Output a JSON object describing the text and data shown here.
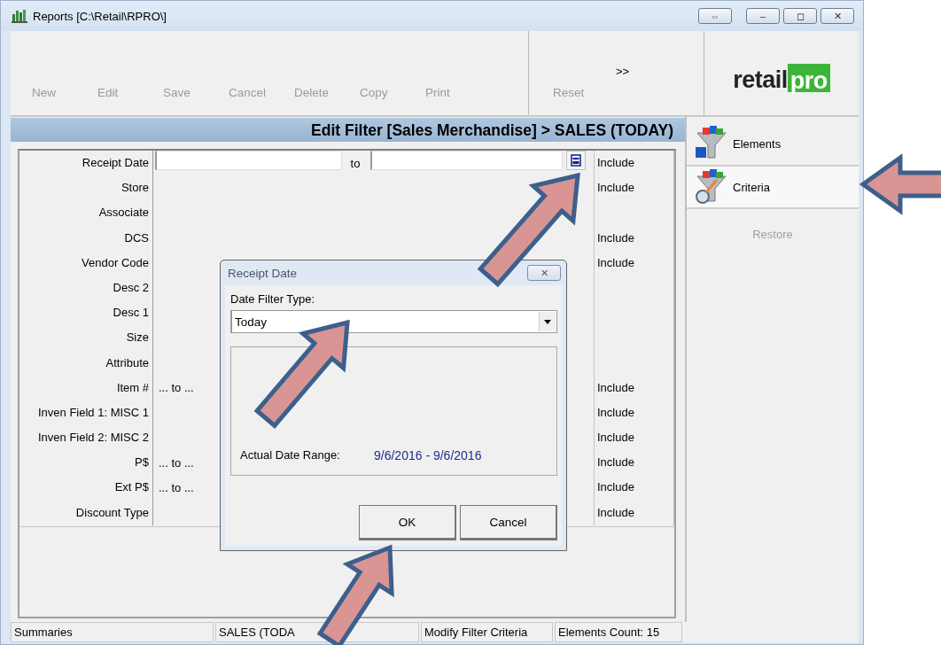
{
  "window": {
    "title": "Reports [C:\\Retail\\RPRO\\]",
    "buttons": [
      "⇔",
      "‒",
      "◻",
      "✕"
    ]
  },
  "toolbar": {
    "buttons": [
      {
        "label": "New",
        "disabled": true
      },
      {
        "label": "Edit",
        "disabled": true
      },
      {
        "label": "Save",
        "disabled": true
      },
      {
        "label": "Cancel",
        "disabled": true
      },
      {
        "label": "Delete",
        "disabled": true
      },
      {
        "label": "Copy",
        "disabled": true
      },
      {
        "label": "Print",
        "disabled": true
      }
    ],
    "reset": {
      "label": "Reset",
      "disabled": true
    },
    "more": ">>"
  },
  "logo": {
    "text_1": "retail",
    "text_2": "pro"
  },
  "header": "Edit Filter [Sales Merchandise] > SALES (TODAY)",
  "filters": [
    {
      "label": "Receipt Date",
      "kind": "date_range",
      "to": "to",
      "include": "Include"
    },
    {
      "label": "Store",
      "kind": "none",
      "include": "Include"
    },
    {
      "label": "Associate",
      "kind": "none"
    },
    {
      "label": "DCS",
      "kind": "none",
      "include": "Include"
    },
    {
      "label": "Vendor Code",
      "kind": "none",
      "include": "Include"
    },
    {
      "label": "Desc 2",
      "kind": "none"
    },
    {
      "label": "Desc 1",
      "kind": "none"
    },
    {
      "label": "Size",
      "kind": "none"
    },
    {
      "label": "Attribute",
      "kind": "none"
    },
    {
      "label": "Item #",
      "kind": "range",
      "value": "... to ...",
      "include": "Include"
    },
    {
      "label": "Inven Field 1: MISC 1",
      "kind": "none",
      "include": "Include"
    },
    {
      "label": "Inven Field 2: MISC 2",
      "kind": "none",
      "include": "Include"
    },
    {
      "label": "P$",
      "kind": "range",
      "value": "... to ...",
      "include": "Include"
    },
    {
      "label": "Ext P$",
      "kind": "range",
      "value": "... to ...",
      "include": "Include"
    },
    {
      "label": "Discount Type",
      "kind": "none",
      "include": "Include"
    }
  ],
  "side_panel": {
    "items": [
      {
        "label": "Elements",
        "selected": false
      },
      {
        "label": "Criteria",
        "selected": true
      }
    ],
    "restore": {
      "label": "Restore",
      "disabled": true
    }
  },
  "dialog": {
    "title": "Receipt Date",
    "close": "✕",
    "field_label": "Date Filter Type:",
    "select_value": "Today",
    "range_label": "Actual Date Range:",
    "range_value": "9/6/2016 - 9/6/2016",
    "buttons": [
      "OK",
      "Cancel"
    ]
  },
  "status_bar": [
    "Summaries",
    "SALES (TODA",
    "Modify Filter Criteria",
    "Elements Count: 15"
  ]
}
